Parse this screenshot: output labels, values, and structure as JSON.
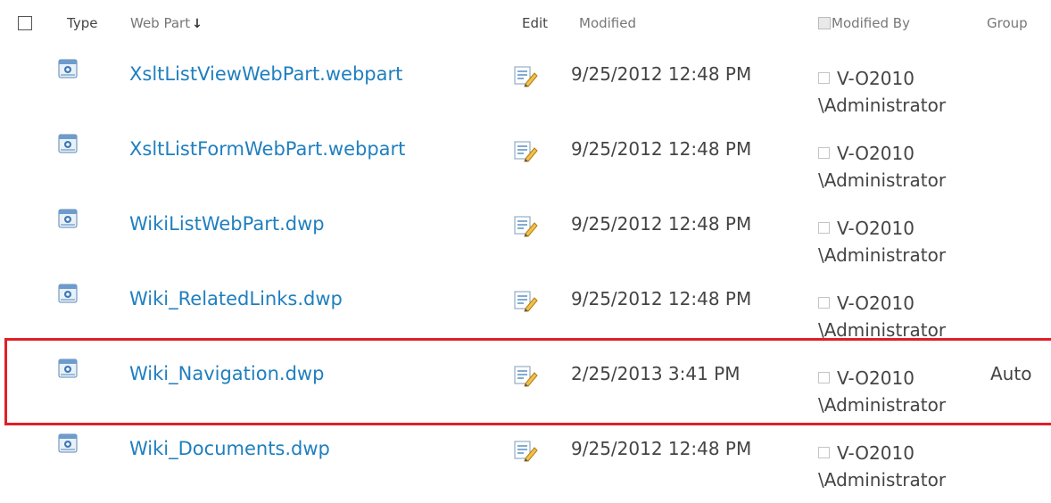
{
  "header": {
    "type": "Type",
    "webpart": "Web Part",
    "sort_arrow": "↓",
    "edit": "Edit",
    "modified": "Modified",
    "modified_by": "Modified By",
    "group": "Group"
  },
  "rows": [
    {
      "name": "XsltListViewWebPart.webpart",
      "modified": "9/25/2012 12:48 PM",
      "modified_by_1": "V-O2010",
      "modified_by_2": "\\Administrator",
      "group": ""
    },
    {
      "name": "XsltListFormWebPart.webpart",
      "modified": "9/25/2012 12:48 PM",
      "modified_by_1": "V-O2010",
      "modified_by_2": "\\Administrator",
      "group": ""
    },
    {
      "name": "WikiListWebPart.dwp",
      "modified": "9/25/2012 12:48 PM",
      "modified_by_1": "V-O2010",
      "modified_by_2": "\\Administrator",
      "group": ""
    },
    {
      "name": "Wiki_RelatedLinks.dwp",
      "modified": "9/25/2012 12:48 PM",
      "modified_by_1": "V-O2010",
      "modified_by_2": "\\Administrator",
      "group": ""
    },
    {
      "name": "Wiki_Navigation.dwp",
      "modified": "2/25/2013 3:41 PM",
      "modified_by_1": "V-O2010",
      "modified_by_2": "\\Administrator",
      "group": "Auto"
    },
    {
      "name": "Wiki_Documents.dwp",
      "modified": "9/25/2012 12:48 PM",
      "modified_by_1": "V-O2010",
      "modified_by_2": "\\Administrator",
      "group": ""
    }
  ],
  "colors": {
    "link": "#1f7fbf",
    "highlight": "#e01f26"
  },
  "icons": {
    "type": "webpart-file-icon",
    "edit": "edit-properties-icon",
    "presence": "presence-indicator-icon"
  }
}
